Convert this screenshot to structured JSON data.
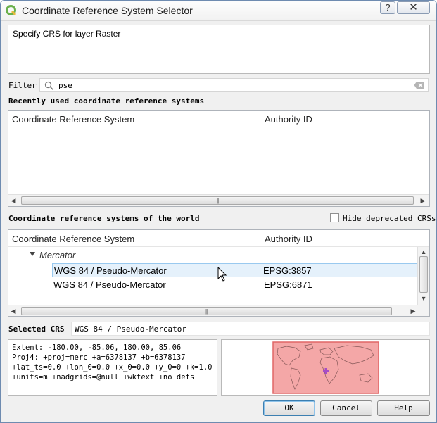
{
  "window": {
    "title": "Coordinate Reference System Selector",
    "help_button": "?",
    "close_button": "✕"
  },
  "description": "Specify CRS for layer Raster",
  "filter": {
    "label": "Filter",
    "value": "pse",
    "icon": "search-icon",
    "clear_icon": "clear-icon"
  },
  "recent": {
    "heading": "Recently used coordinate reference systems",
    "columns": [
      "Coordinate Reference System",
      "Authority ID"
    ],
    "rows": []
  },
  "world": {
    "heading": "Coordinate reference systems of the world",
    "hide_deprecated_label": "Hide deprecated CRSs",
    "hide_deprecated_checked": false,
    "columns": [
      "Coordinate Reference System",
      "Authority ID"
    ],
    "group": "Mercator",
    "rows": [
      {
        "name": "WGS 84 / Pseudo-Mercator",
        "authority_id": "EPSG:3857",
        "selected": true
      },
      {
        "name": "WGS 84 / Pseudo-Mercator",
        "authority_id": "EPSG:6871",
        "selected": false
      }
    ]
  },
  "selected_crs": {
    "label": "Selected CRS",
    "value": "WGS 84 / Pseudo-Mercator"
  },
  "details": {
    "lines": [
      "Extent: -180.00, -85.06, 180.00, 85.06",
      "Proj4: +proj=merc +a=6378137 +b=6378137",
      "+lat_ts=0.0 +lon_0=0.0 +x_0=0.0 +y_0=0 +k=1.0",
      "+units=m +nadgrids=@null +wktext +no_defs"
    ]
  },
  "colors": {
    "extent_fill": "#f4a7a7",
    "extent_border": "#e06666",
    "crosshair": "#a64dc6",
    "selection": "#e5f1fb"
  },
  "buttons": {
    "ok": "OK",
    "cancel": "Cancel",
    "help": "Help"
  }
}
